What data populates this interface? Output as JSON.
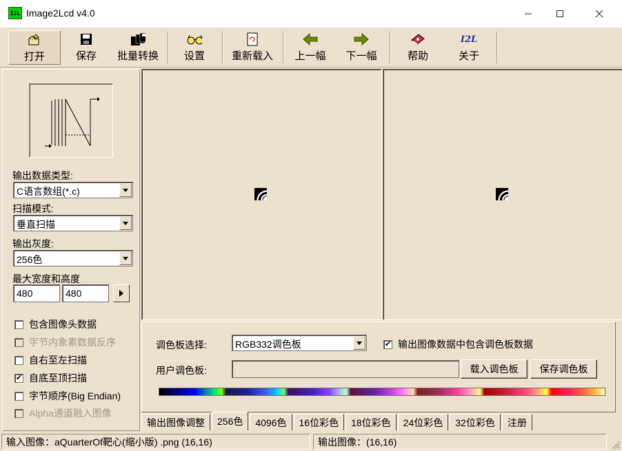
{
  "window": {
    "title": "Image2Lcd v4.0",
    "icon_text": "I2L",
    "minimize_icon": "minimize-icon",
    "maximize_icon": "maximize-icon",
    "close_icon": "close-icon"
  },
  "toolbar": {
    "open": "打开",
    "save": "保存",
    "batch": "批量转换",
    "settings": "设置",
    "reload": "重新载入",
    "prev": "上一幅",
    "next": "下一幅",
    "help": "帮助",
    "about": "关于",
    "about_icon_text": "I2L"
  },
  "left": {
    "output_type_label": "输出数据类型:",
    "output_type_value": "C语言数组(*.c)",
    "scan_mode_label": "扫描模式:",
    "scan_mode_value": "垂直扫描",
    "gray_label": "输出灰度:",
    "gray_value": "256色",
    "size_label": "最大宽度和高度",
    "max_width": "480",
    "max_height": "480",
    "checks": [
      {
        "label": "包含图像头数据",
        "checked": false,
        "disabled": false
      },
      {
        "label": "字节内象素数据反序",
        "checked": false,
        "disabled": true
      },
      {
        "label": "自右至左扫描",
        "checked": false,
        "disabled": false
      },
      {
        "label": "自底至顶扫描",
        "checked": true,
        "disabled": false
      },
      {
        "label": "字节顺序(Big Endian)",
        "checked": false,
        "disabled": false
      },
      {
        "label": "Alpha通道融入图像",
        "checked": false,
        "disabled": true
      }
    ]
  },
  "palette_panel": {
    "select_label": "调色板选择:",
    "select_value": "RGB332调色板",
    "include_label": "输出图像数据中包含调色板数据",
    "include_checked": true,
    "user_palette_label": "用户调色板:",
    "user_palette_value": "",
    "load_button": "载入调色板",
    "save_button": "保存调色板"
  },
  "tabs": [
    "输出图像调整",
    "256色",
    "4096色",
    "16位彩色",
    "18位彩色",
    "24位彩色",
    "32位彩色",
    "注册"
  ],
  "active_tab": 1,
  "status": {
    "input": "输入图像：aQuarterOf靶心(缩小版) .png (16,16)",
    "output": "输出图像：(16,16)"
  },
  "colors": {
    "face": "#ece0cf",
    "titlebar": "#ffffff",
    "icon_green": "#13c813"
  }
}
